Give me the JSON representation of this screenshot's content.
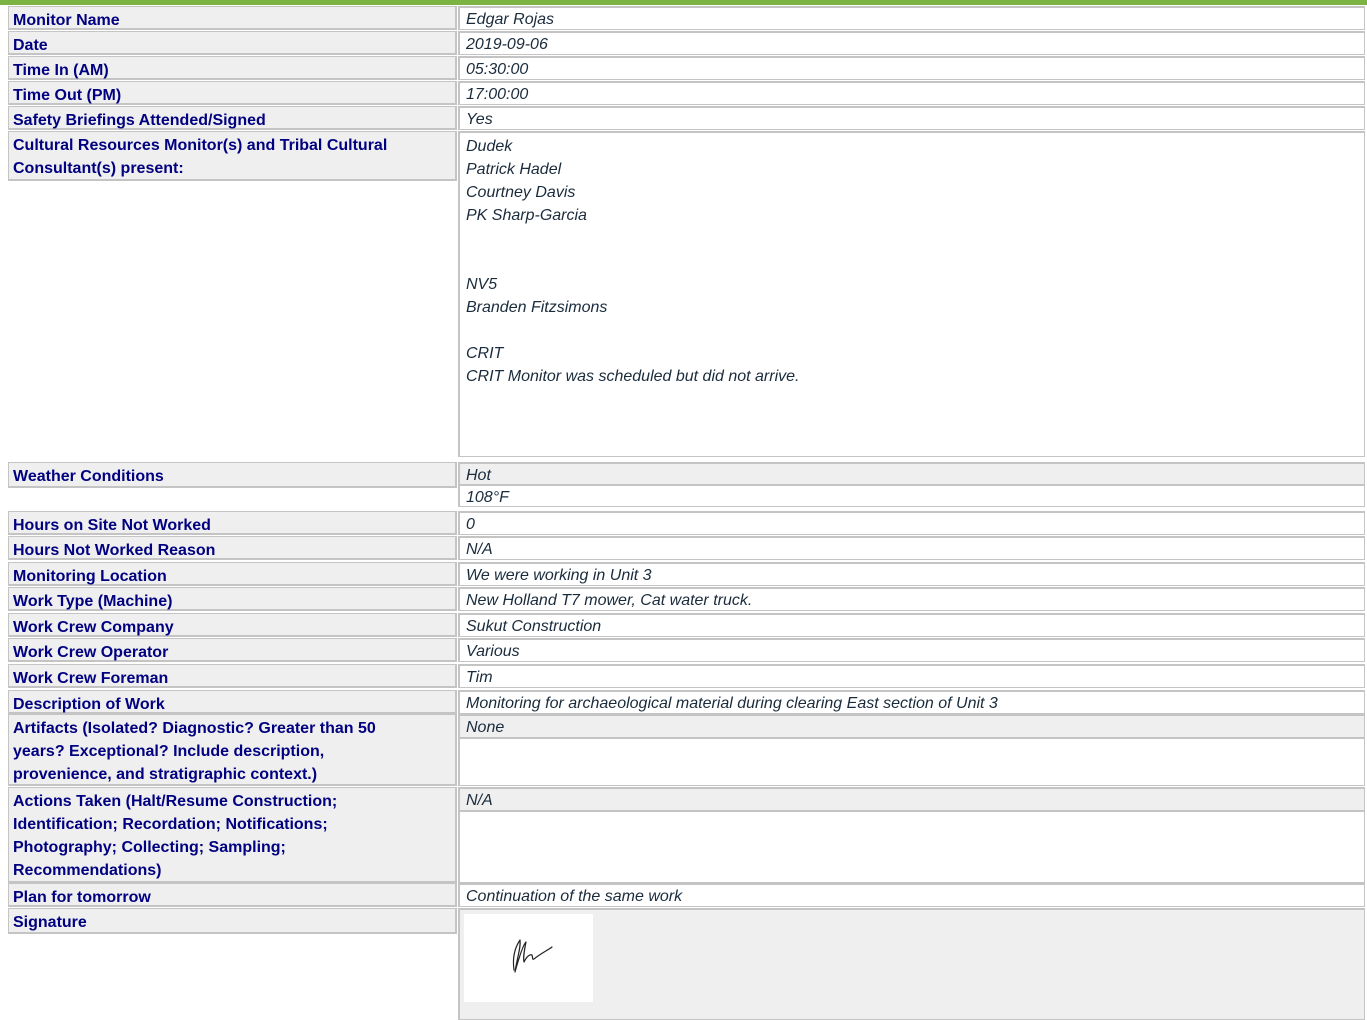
{
  "form": {
    "monitor_name": {
      "label": "Monitor Name",
      "value": "Edgar Rojas"
    },
    "date": {
      "label": "Date",
      "value": "2019-09-06"
    },
    "time_in": {
      "label": "Time In (AM)",
      "value": "05:30:00"
    },
    "time_out": {
      "label": "Time Out (PM)",
      "value": "17:00:00"
    },
    "safety": {
      "label": "Safety Briefings Attended/Signed",
      "value": "Yes"
    },
    "cultural": {
      "label_line1": "Cultural Resources Monitor(s) and Tribal Cultural",
      "label_line2": "Consultant(s) present:",
      "lines": [
        "Dudek",
        "Patrick Hadel",
        "Courtney Davis",
        "PK Sharp-Garcia",
        "",
        "",
        "NV5",
        "Branden Fitzsimons",
        "",
        "CRIT",
        "CRIT Monitor was scheduled but did not arrive."
      ]
    },
    "weather": {
      "label": "Weather Conditions",
      "line1": "Hot",
      "line2": "108°F"
    },
    "hours_not_worked": {
      "label": "Hours on Site Not Worked",
      "value": "0"
    },
    "hours_reason": {
      "label": "Hours Not Worked Reason",
      "value": "N/A"
    },
    "location": {
      "label": "Monitoring Location",
      "value": "We were working in Unit 3"
    },
    "work_type": {
      "label": "Work Type (Machine)",
      "value": "New Holland T7 mower, Cat water truck."
    },
    "crew_company": {
      "label": "Work Crew Company",
      "value": "Sukut Construction"
    },
    "crew_operator": {
      "label": "Work Crew Operator",
      "value": "Various"
    },
    "crew_foreman": {
      "label": "Work Crew Foreman",
      "value": "Tim"
    },
    "description": {
      "label": "Description of Work",
      "value": "Monitoring for archaeological material during clearing East section of Unit 3"
    },
    "artifacts": {
      "label_lines": [
        "Artifacts (Isolated? Diagnostic? Greater than 50",
        "years? Exceptional?  Include description,",
        "provenience, and stratigraphic context.)"
      ],
      "value": "None"
    },
    "actions": {
      "label_lines": [
        "Actions Taken (Halt/Resume Construction;",
        "Identification; Recordation; Notifications;",
        "Photography; Collecting; Sampling;",
        "Recommendations)"
      ],
      "value": "N/A"
    },
    "plan": {
      "label": "Plan for tomorrow",
      "value": "Continuation of the same work"
    },
    "signature": {
      "label": "Signature"
    }
  }
}
